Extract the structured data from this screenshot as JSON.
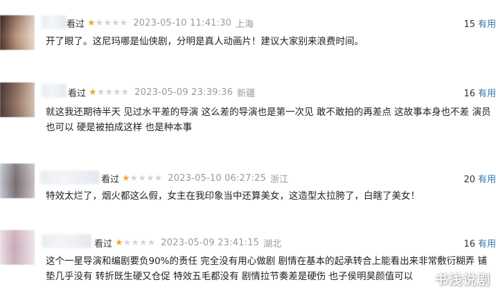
{
  "reviews": [
    {
      "seen_label": "看过",
      "rating": 1,
      "max_rating": 5,
      "time": "2023-05-10 11:41:30",
      "location": "上海",
      "useful_count": "15",
      "useful_label": "有用",
      "text": "开了眼了。这尼玛哪是仙侠剧，分明是真人动画片！建议大家别来浪费时间。"
    },
    {
      "seen_label": "看过",
      "rating": 1,
      "max_rating": 5,
      "time": "2023-05-09 23:39:36",
      "location": "新疆",
      "useful_count": "16",
      "useful_label": "有用",
      "text": "就这我还期待半天 见过水平差的导演 这么差的导演也是第一次见 敢不敢拍的再差点 这故事本身也不差 演员也可以 硬是被拍成这样 也是种本事"
    },
    {
      "seen_label": "看过",
      "rating": 1,
      "max_rating": 5,
      "time": "2023-05-10 06:27:25",
      "location": "浙江",
      "useful_count": "20",
      "useful_label": "有用",
      "text": "特效太烂了，烟火都这么假，女主在我印象当中还算美女，这造型太拉胯了，白瞎了美女！"
    },
    {
      "seen_label": "看过",
      "rating": 1,
      "max_rating": 5,
      "time": "2023-05-09 23:41:15",
      "location": "湖北",
      "useful_count": "16",
      "useful_label": "有用",
      "text": "这个一星导演和编剧要负90%的责任 完全没有用心做剧 剧情在基本的起承转合上能看出来非常敷衍糊弄 铺垫几乎没有 转折既生硬又仓促 特效五毛都没有 剧情拉节奏差是硬伤 也子侯明昊颜值可以"
    }
  ],
  "watermark": "书浅说剧",
  "colors": {
    "star_on": "#f6a623",
    "star_off": "#d4d4d4",
    "useful_link": "#3377aa",
    "meta_gray": "#9a9a9a"
  }
}
